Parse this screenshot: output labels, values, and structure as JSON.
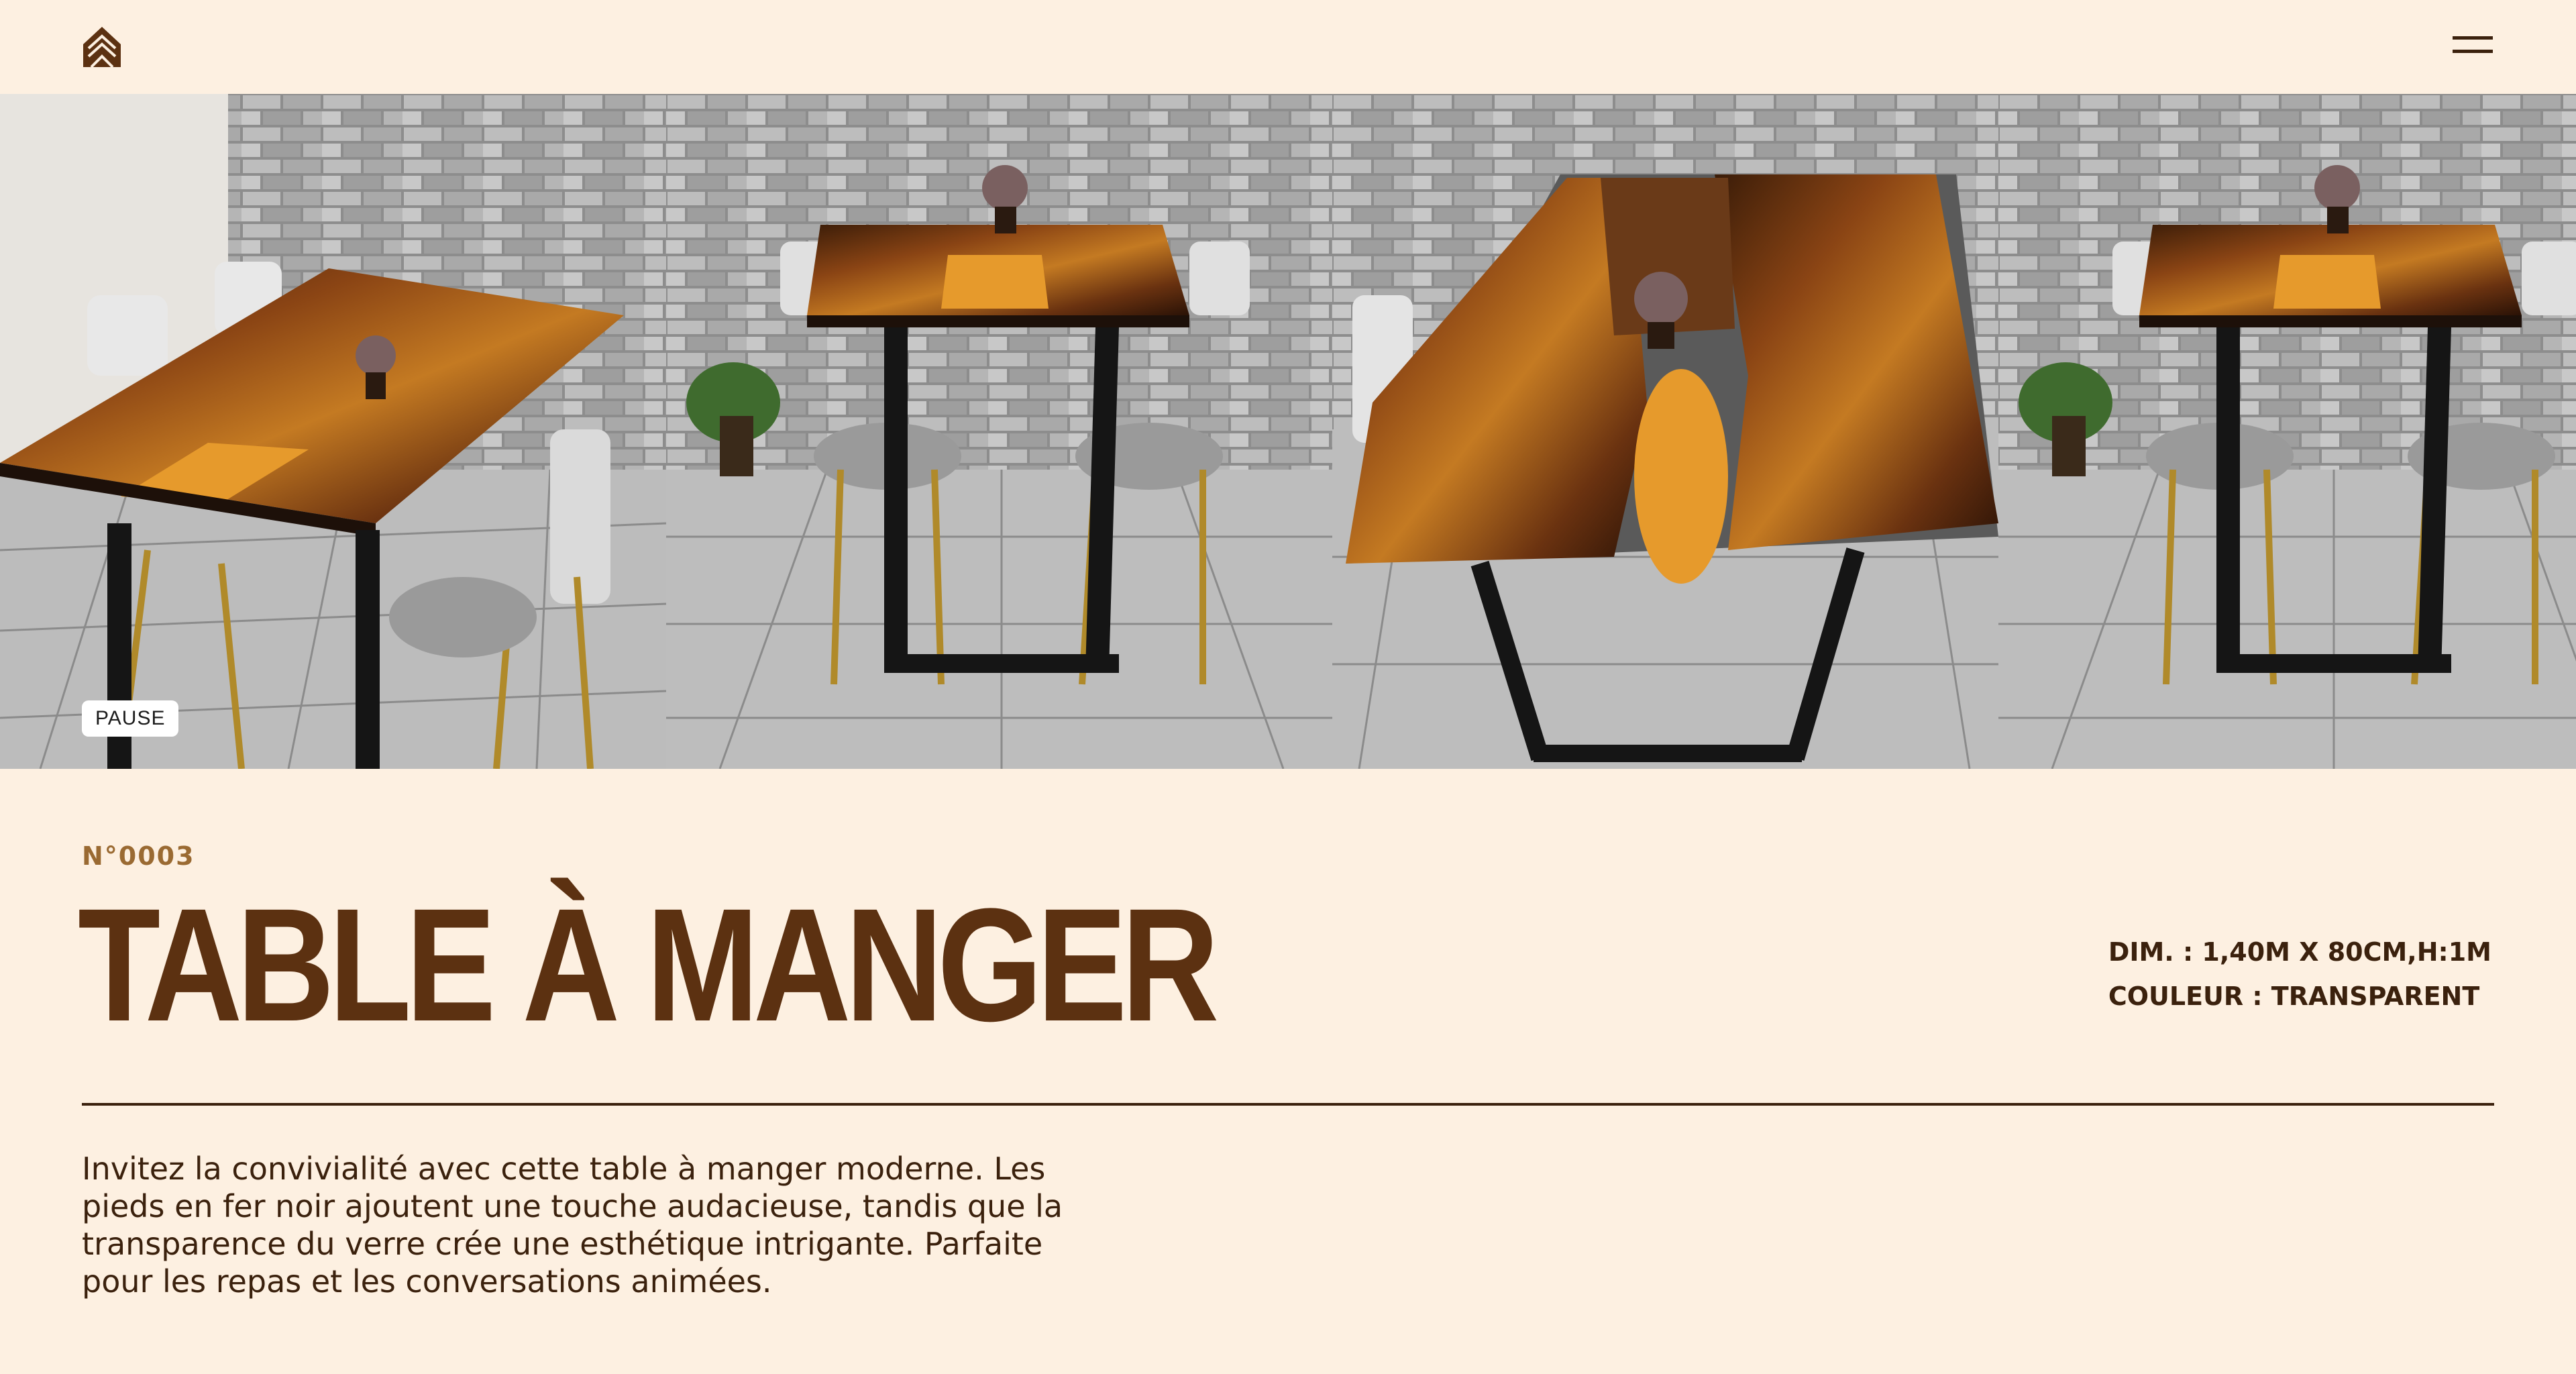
{
  "header": {
    "logo_icon": "house-chevron-logo",
    "menu_icon": "hamburger-menu-icon"
  },
  "gallery": {
    "pause_label": "PAUSE",
    "images": [
      {
        "name": "table-angle-view-left"
      },
      {
        "name": "table-end-view"
      },
      {
        "name": "table-top-view"
      },
      {
        "name": "table-end-view-repeat"
      }
    ]
  },
  "product": {
    "number": "N°0003",
    "title": "TABLE À MANGER",
    "dimensions": "DIM. : 1,40M X 80CM,H:1M",
    "color": "COULEUR : TRANSPARENT",
    "description": "Invitez la convivialité avec cette table à manger moderne. Les pieds en fer noir ajoutent une touche audacieuse, tandis que la transparence du verre crée une esthétique intrigante. Parfaite pour les repas et les conversations animées."
  },
  "colors": {
    "background": "#fdf0e1",
    "title": "#5c3111",
    "accent": "#9a6a32",
    "text": "#3b210d"
  }
}
